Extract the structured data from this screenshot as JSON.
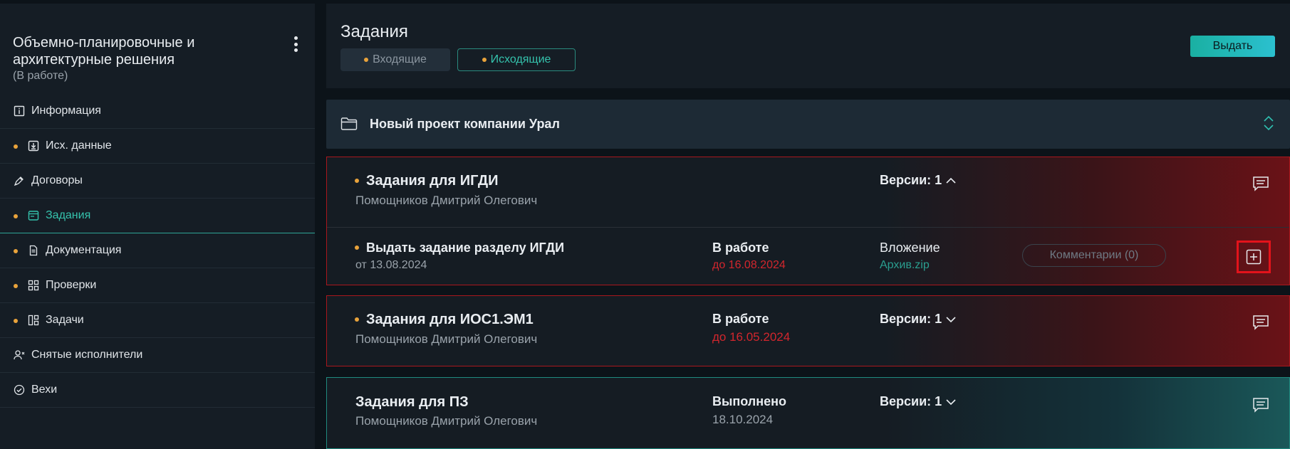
{
  "sidebar": {
    "title": "Объемно-планировочные и архитектурные решения",
    "status": "(В работе)",
    "items": [
      {
        "label": "Информация",
        "icon": "info-icon",
        "dot": false
      },
      {
        "label": "Исх. данные",
        "icon": "download-icon",
        "dot": true
      },
      {
        "label": "Договоры",
        "icon": "pen-icon",
        "dot": false
      },
      {
        "label": "Задания",
        "icon": "tasks-window-icon",
        "dot": true,
        "active": true
      },
      {
        "label": "Документация",
        "icon": "document-icon",
        "dot": true
      },
      {
        "label": "Проверки",
        "icon": "grid-icon",
        "dot": true
      },
      {
        "label": "Задачи",
        "icon": "board-icon",
        "dot": true
      },
      {
        "label": "Снятые исполнители",
        "icon": "user-removed-icon",
        "dot": false
      },
      {
        "label": "Вехи",
        "icon": "check-circle-icon",
        "dot": false
      }
    ]
  },
  "header": {
    "title": "Задания",
    "tabs": [
      {
        "label": "Входящие"
      },
      {
        "label": "Исходящие"
      }
    ],
    "issue_button": "Выдать"
  },
  "project": {
    "name": "Новый проект компании Урал"
  },
  "cards": [
    {
      "title": "Задания для ИГДИ",
      "author": "Помощников Дмитрий Олегович",
      "versions": "Версии: 1",
      "sub": {
        "title": "Выдать задание разделу ИГДИ",
        "from": "от 13.08.2024",
        "status": "В работе",
        "deadline": "до 16.08.2024",
        "attach_label": "Вложение",
        "attach_file": "Архив.zip",
        "comments": "Комментарии (0)"
      }
    },
    {
      "title": "Задания для ИОС1.ЭМ1",
      "author": "Помощников Дмитрий Олегович",
      "status": "В работе",
      "deadline": "до 16.05.2024",
      "versions": "Версии: 1"
    },
    {
      "title": "Задания для ПЗ",
      "author": "Помощников Дмитрий Олегович",
      "status": "Выполнено",
      "date": "18.10.2024",
      "versions": "Версии: 1"
    }
  ],
  "colors": {
    "accent": "#35c3ad",
    "dot": "#e9a33b",
    "danger": "#d2262d",
    "highlight": "#e3131b"
  }
}
